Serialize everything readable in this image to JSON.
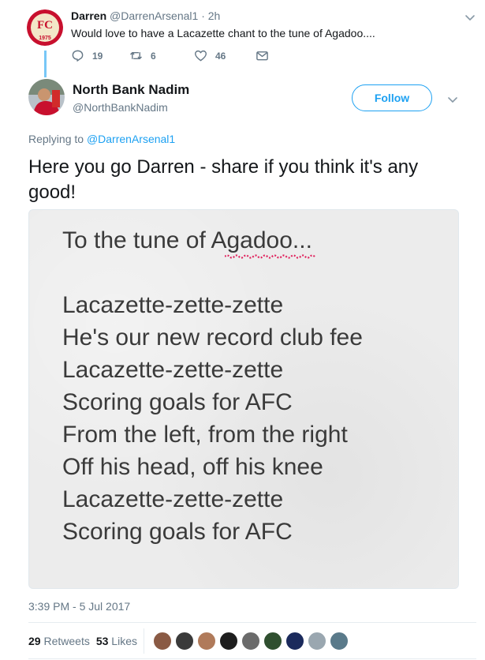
{
  "parent_tweet": {
    "name": "Darren",
    "handle": "@DarrenArsenal1",
    "separator": "·",
    "time": "2h",
    "text": "Would love to have a Lacazette chant to the tune of Agadoo....",
    "avatar_text": "1975",
    "actions": {
      "replies": "19",
      "retweets": "6",
      "likes": "46"
    }
  },
  "main_tweet": {
    "name": "North Bank Nadim",
    "handle": "@NorthBankNadim",
    "follow_label": "Follow",
    "replying_prefix": "Replying to",
    "replying_to": "@DarrenArsenal1",
    "text": "Here you go Darren - share if you think it's any good!",
    "image_lines": [
      "To the tune of Agadoo...",
      "",
      "Lacazette-zette-zette",
      "He's our new record club fee",
      "Lacazette-zette-zette",
      "Scoring goals for AFC",
      "From the left, from the right",
      "Off his head, off his knee",
      "Lacazette-zette-zette",
      "Scoring goals for AFC"
    ],
    "timestamp": "3:39 PM - 5 Jul 2017",
    "stats": {
      "retweets_count": "29",
      "retweets_label": "Retweets",
      "likes_count": "53",
      "likes_label": "Likes"
    }
  },
  "colors": {
    "accent": "#1da1f2",
    "muted": "#657786",
    "text": "#14171a",
    "avatar_red": "#c8102e"
  },
  "liker_colors": [
    "#8a5a44",
    "#3a3a3a",
    "#b07a5a",
    "#1e1e1e",
    "#6b6b6b",
    "#2f4f2f",
    "#1b2a5c",
    "#9aa7b0",
    "#5a7a8a"
  ]
}
